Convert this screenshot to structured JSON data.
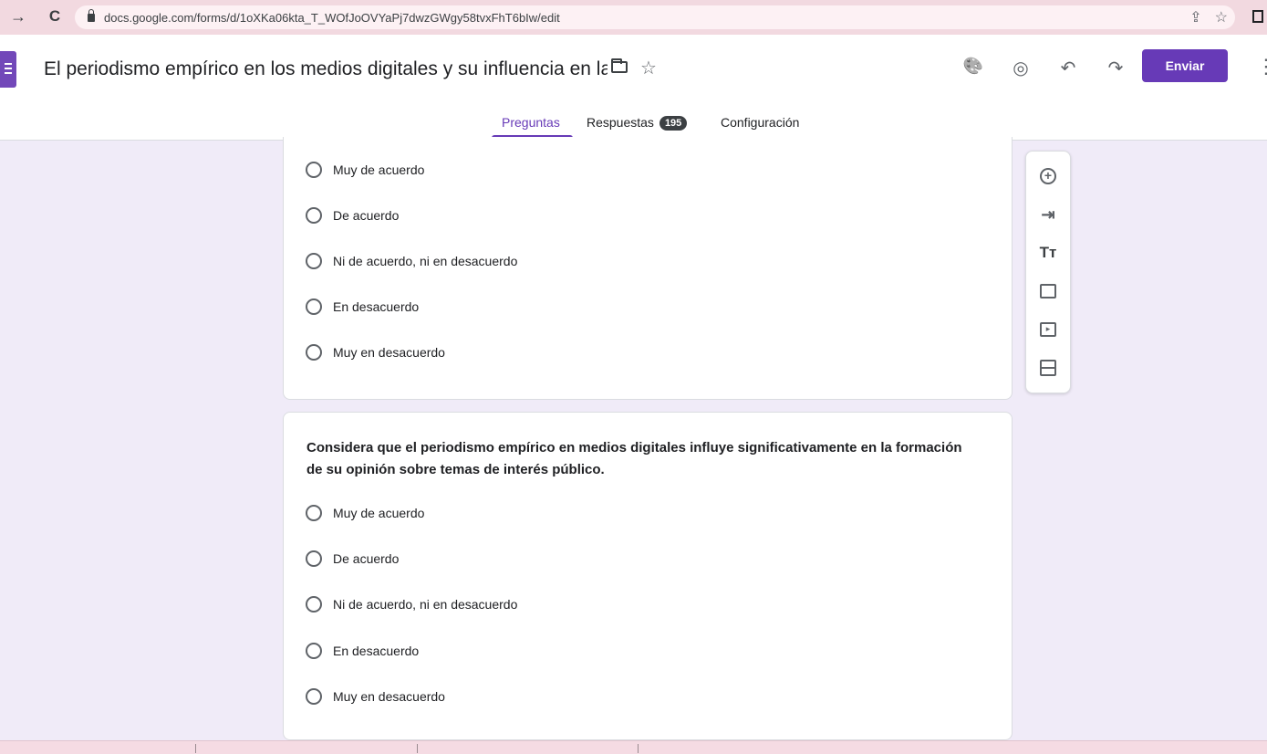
{
  "browser": {
    "back_icon": "→",
    "reload_icon": "C",
    "url": "docs.google.com/forms/d/1oXKa06kta_T_WOfJoOVYaPj7dwzGWgy58tvxFhT6bIw/edit",
    "share_icon": "⇪",
    "star_icon": "☆"
  },
  "header": {
    "title": "El periodismo empírico en los medios digitales y su influencia en la opinión pública",
    "star_icon": "☆",
    "palette_icon": "🎨",
    "preview_icon": "◎",
    "undo_icon": "↶",
    "redo_icon": "↷",
    "send_label": "Enviar",
    "more_icon": "⋮"
  },
  "tabs": {
    "questions": "Preguntas",
    "responses": "Respuestas",
    "responses_count": "195",
    "settings": "Configuración"
  },
  "question1": {
    "options": [
      "Muy de acuerdo",
      "De acuerdo",
      "Ni de acuerdo, ni en desacuerdo",
      "En desacuerdo",
      "Muy en desacuerdo"
    ]
  },
  "question2": {
    "text": "Considera que el periodismo empírico en medios digitales influye significativamente en la formación de su opinión sobre temas de interés público.",
    "options": [
      "Muy de acuerdo",
      "De acuerdo",
      "Ni de acuerdo, ni en desacuerdo",
      "En desacuerdo",
      "Muy en desacuerdo"
    ]
  },
  "tools": {
    "add_question_icon": "+",
    "import_icon": "⇥",
    "title_icon": "Tт",
    "image_icon": "▣",
    "video_icon": "▸",
    "section_icon": "☰"
  },
  "colors": {
    "accent": "#673ab7",
    "background": "#f0ebf8"
  }
}
